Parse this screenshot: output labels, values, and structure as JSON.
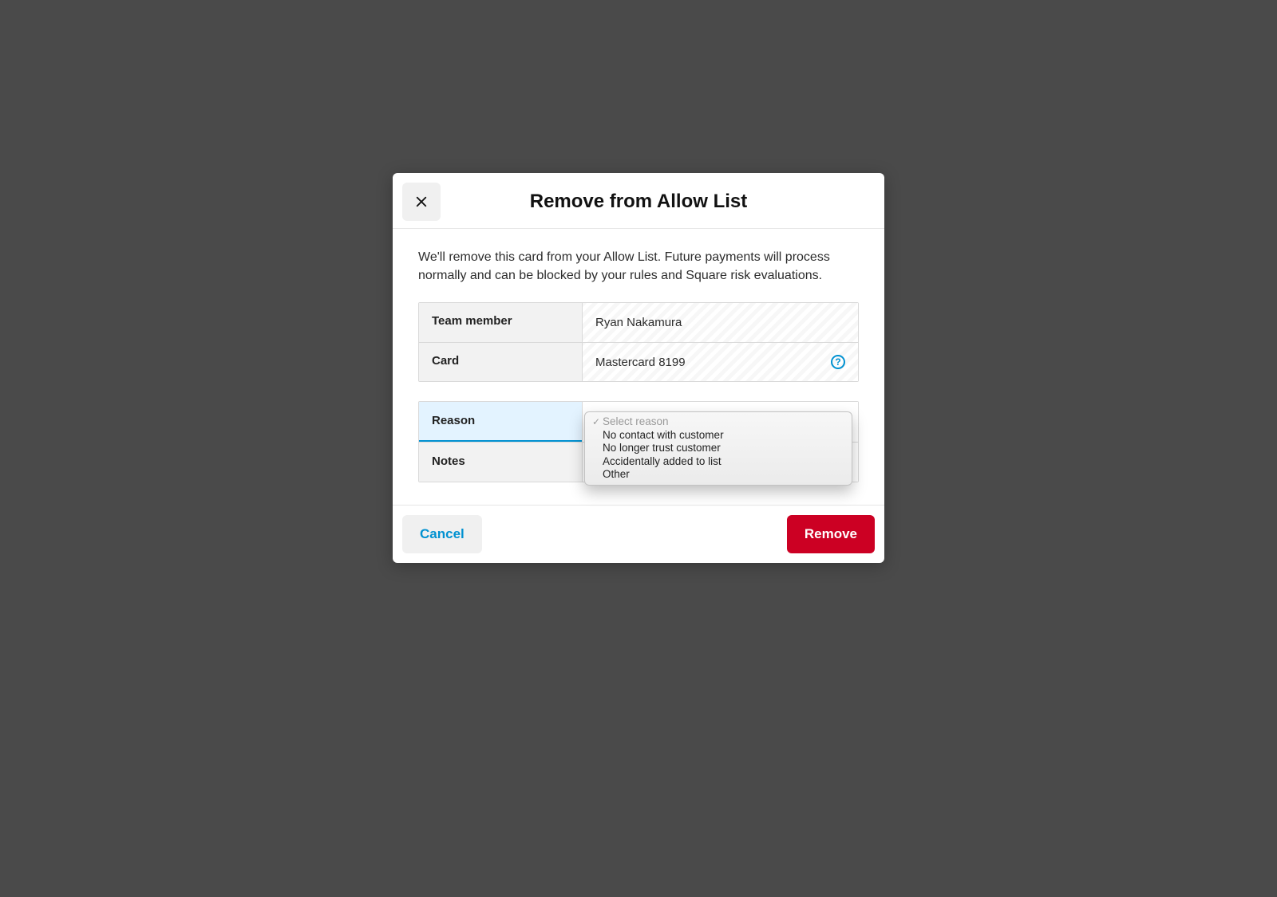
{
  "modal": {
    "title": "Remove from Allow List",
    "description": "We'll remove this card from your Allow List. Future payments will process normally and can be blocked by your rules and Square risk evaluations.",
    "info": {
      "team_member_label": "Team member",
      "team_member_value": "Ryan Nakamura",
      "card_label": "Card",
      "card_value": "Mastercard 8199"
    },
    "form": {
      "reason_label": "Reason",
      "reason_placeholder": "Select reason",
      "reason_options": [
        "No contact with customer",
        "No longer trust customer",
        "Accidentally added to list",
        "Other"
      ],
      "notes_label": "Notes"
    },
    "footer": {
      "cancel_label": "Cancel",
      "remove_label": "Remove"
    }
  }
}
